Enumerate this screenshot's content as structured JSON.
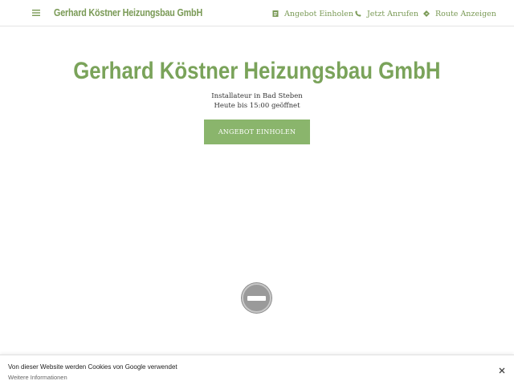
{
  "header": {
    "brand": "Gerhard Köstner Heizungsbau GmbH",
    "nav": [
      {
        "label": "Angebot Einholen",
        "icon": "document-icon"
      },
      {
        "label": "Jetzt Anrufen",
        "icon": "phone-icon"
      },
      {
        "label": "Route Anzeigen",
        "icon": "directions-icon"
      }
    ]
  },
  "hero": {
    "title": "Gerhard Köstner Heizungsbau GmbH",
    "category": "Installateur in Bad Steben",
    "hours": "Heute bis 15:00 geöffnet",
    "cta_label": "ANGEBOT EINHOLEN"
  },
  "cookie_banner": {
    "text": "Von dieser Website werden Cookies von Google verwendet",
    "link": "Weitere Informationen"
  },
  "colors": {
    "accent": "#7aa35a",
    "button": "#8ab56c"
  }
}
